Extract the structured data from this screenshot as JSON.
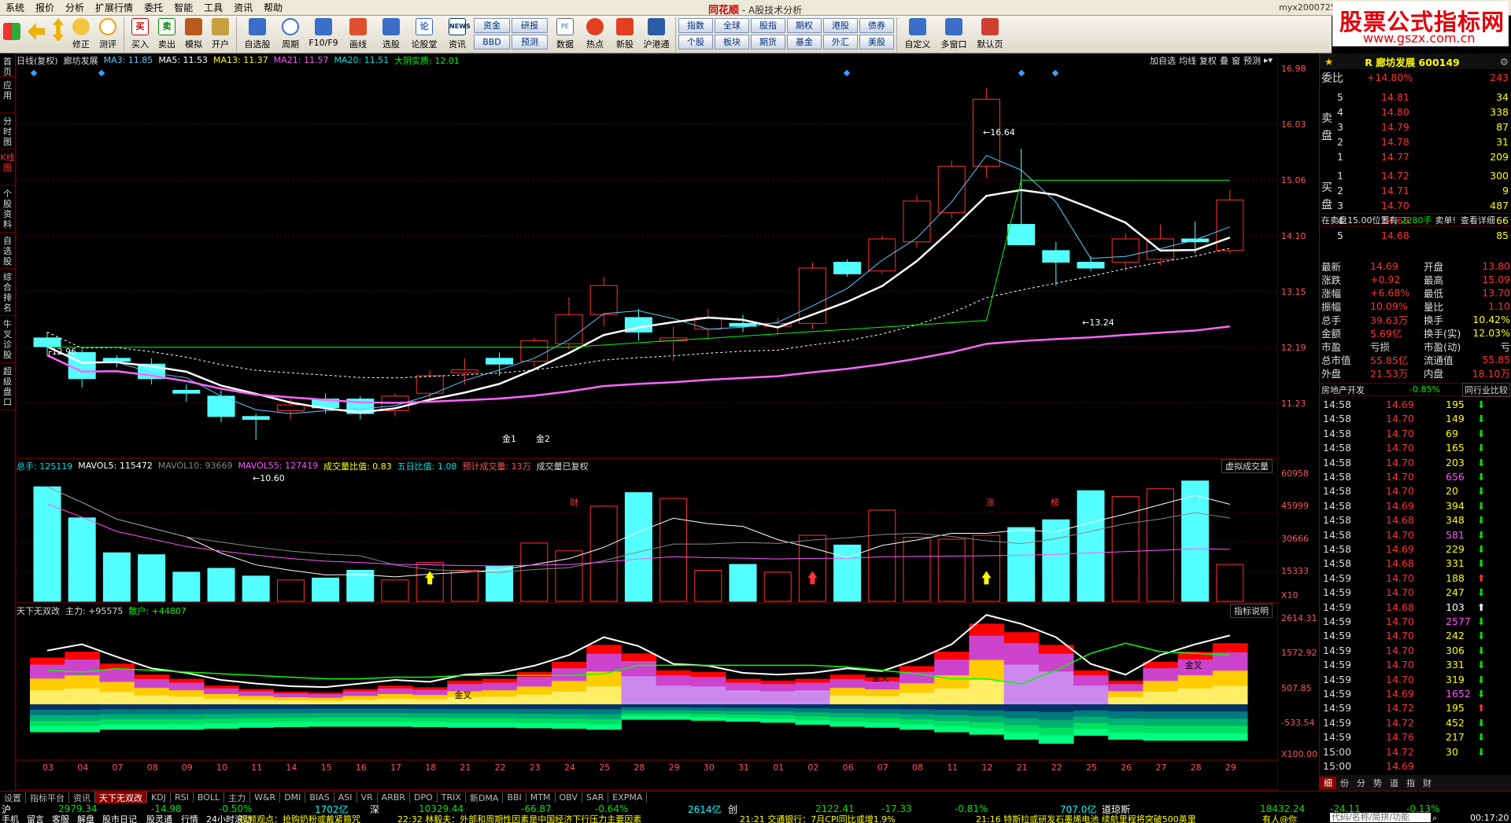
{
  "menu": {
    "items": [
      "系统",
      "报价",
      "分析",
      "扩展行情",
      "委托",
      "智能",
      "工具",
      "资讯",
      "帮助"
    ],
    "app_logo": "同花顺",
    "title": "A股技术分析",
    "user": "myx2000725"
  },
  "site_logo": {
    "line1": "股票公式指标网",
    "line2": "www.gszx.com.cn"
  },
  "toolbar": {
    "buttons": [
      "修正",
      "测评",
      "买入",
      "卖出",
      "模拟",
      "开户",
      "自选股",
      "周期",
      "F10/F9",
      "画线",
      "选股",
      "论股堂",
      "资讯",
      "数据",
      "热点",
      "新股",
      "沪港通",
      "自定义",
      "多窗口",
      "默认页"
    ],
    "grid1": [
      "资金",
      "研报",
      "BBD",
      "预测"
    ],
    "grid2": [
      "指数",
      "全球",
      "股指",
      "期权",
      "港股",
      "债券",
      "个股",
      "板块",
      "期货",
      "基金",
      "外汇",
      "美股"
    ]
  },
  "leftbar": [
    "首页",
    "应用",
    "分时图",
    "K线图",
    "个股资料",
    "自选股",
    "综合排名",
    "牛叉诊股",
    "超级盘口"
  ],
  "kline_header": {
    "period": "日线(复权)",
    "name": "廊坊发展",
    "ma3": "MA3: 11.85",
    "ma5": "MA5: 11.53",
    "ma13": "MA13: 11.37",
    "ma21": "MA21: 11.57",
    "ma20": "MA20: 11.51",
    "dayang": "大阴实质: 12.01",
    "tools": [
      "加自选",
      "均线",
      "复权",
      "叠",
      "窗",
      "预测"
    ]
  },
  "volume_header": {
    "total": "总手: 125119",
    "mavol5": "MAVOL5: 115472",
    "mavol10": "MAVOL10: 93669",
    "mavol55": "MAVOL55: 127419",
    "ratio": "成交量比值: 0.83",
    "five_day": "五日比值: 1.08",
    "forecast": "预计成交量: 13万",
    "restored": "成交量已复权",
    "menu": "虚拟成交量"
  },
  "indicator_header": {
    "name": "天下无双改",
    "main_force": "主力: +95575",
    "retail": "散户: +44807",
    "help": "指标说明"
  },
  "kline_axis": [
    "16.98",
    "16.03",
    "15.06",
    "14.10",
    "13.15",
    "12.19",
    "11.23"
  ],
  "volume_axis": [
    "60958",
    "45999",
    "30666",
    "15333",
    "X10"
  ],
  "indicator_axis": [
    "2614.31",
    "1572.92",
    "507.85",
    "-533.54",
    "X100.00"
  ],
  "dates": [
    "03",
    "04",
    "07",
    "08",
    "09",
    "10",
    "11",
    "14",
    "15",
    "16",
    "17",
    "18",
    "21",
    "22",
    "23",
    "24",
    "25",
    "28",
    "29",
    "30",
    "31",
    "01",
    "02",
    "06",
    "07",
    "08",
    "11",
    "12",
    "21",
    "22",
    "25",
    "26",
    "27",
    "28",
    "29"
  ],
  "annotations": {
    "high": "16.64",
    "low": "10.60",
    "mid_low": "13.24",
    "left_high": "12.96",
    "cross1": "金1",
    "cross2": "金2",
    "cross3": "金叉",
    "cross4": "金叉",
    "cross5": "金叉",
    "bottom_marks": [
      "财",
      "涨",
      "榜"
    ]
  },
  "chart_data": {
    "type": "candlestick",
    "ohlc": [
      [
        12.35,
        12.45,
        12.05,
        12.2
      ],
      [
        12.1,
        12.15,
        11.5,
        11.65
      ],
      [
        12.0,
        12.05,
        11.85,
        11.95
      ],
      [
        11.9,
        12.0,
        11.55,
        11.65
      ],
      [
        11.45,
        11.55,
        11.25,
        11.4
      ],
      [
        11.35,
        11.45,
        10.9,
        11.0
      ],
      [
        11.0,
        11.05,
        10.6,
        10.95
      ],
      [
        11.1,
        11.3,
        10.95,
        11.2
      ],
      [
        11.3,
        11.4,
        11.05,
        11.15
      ],
      [
        11.3,
        11.35,
        10.95,
        11.05
      ],
      [
        11.1,
        11.4,
        11.0,
        11.35
      ],
      [
        11.4,
        11.8,
        11.25,
        11.7
      ],
      [
        11.75,
        12.0,
        11.55,
        11.8
      ],
      [
        12.0,
        12.1,
        11.7,
        11.9
      ],
      [
        11.95,
        12.35,
        11.85,
        12.3
      ],
      [
        12.25,
        13.05,
        12.15,
        12.75
      ],
      [
        12.75,
        13.4,
        12.55,
        13.25
      ],
      [
        12.7,
        12.85,
        12.3,
        12.45
      ],
      [
        12.3,
        12.55,
        11.95,
        12.35
      ],
      [
        12.5,
        12.85,
        12.35,
        12.7
      ],
      [
        12.6,
        12.75,
        12.45,
        12.55
      ],
      [
        12.55,
        12.7,
        12.4,
        12.6
      ],
      [
        12.6,
        13.65,
        12.5,
        13.55
      ],
      [
        13.65,
        13.7,
        13.4,
        13.45
      ],
      [
        13.5,
        14.1,
        13.45,
        14.05
      ],
      [
        14.0,
        14.8,
        13.9,
        14.7
      ],
      [
        14.5,
        15.4,
        14.4,
        15.3
      ],
      [
        15.3,
        16.64,
        15.1,
        16.45
      ],
      [
        14.3,
        15.6,
        14.0,
        13.95
      ],
      [
        13.85,
        14.0,
        13.24,
        13.65
      ],
      [
        13.65,
        13.75,
        13.5,
        13.55
      ],
      [
        13.65,
        14.15,
        13.5,
        14.05
      ],
      [
        13.7,
        14.3,
        13.6,
        14.05
      ],
      [
        14.05,
        14.35,
        13.8,
        14.0
      ],
      [
        13.85,
        14.9,
        13.8,
        14.72
      ]
    ],
    "volume": [
      59000,
      43000,
      25000,
      24000,
      15000,
      17000,
      13000,
      11000,
      12000,
      16000,
      11000,
      20000,
      16000,
      18000,
      30000,
      26000,
      49000,
      56000,
      53000,
      16000,
      19000,
      15000,
      34000,
      29000,
      47000,
      33000,
      32000,
      34000,
      38000,
      42000,
      57000,
      54000,
      58000,
      62000,
      19000
    ]
  },
  "right_panel": {
    "stock_label": "R 廊坊发展 600149",
    "weibi_label": "委比",
    "weibi": "+14.80%",
    "weicha": "243",
    "sell": [
      [
        "5",
        "14.81",
        "34"
      ],
      [
        "4",
        "14.80",
        "338"
      ],
      [
        "3",
        "14.79",
        "87"
      ],
      [
        "2",
        "14.78",
        "31"
      ],
      [
        "1",
        "14.77",
        "209"
      ]
    ],
    "buy": [
      [
        "1",
        "14.72",
        "300"
      ],
      [
        "2",
        "14.71",
        "9"
      ],
      [
        "3",
        "14.70",
        "487"
      ],
      [
        "4",
        "14.69",
        "66"
      ],
      [
        "5",
        "14.68",
        "85"
      ]
    ],
    "sell_side": "卖",
    "sell_side2": "盘",
    "buy_side": "买",
    "buy_side2": "盘",
    "msg": [
      "在卖盘15.00位置有",
      "2280手",
      "卖单!",
      "查看详细"
    ],
    "stats": [
      [
        "最新",
        "14.69",
        "开盘",
        "13.80"
      ],
      [
        "涨跌",
        "+0.92",
        "最高",
        "15.09"
      ],
      [
        "涨幅",
        "+6.68%",
        "最低",
        "13.70"
      ],
      [
        "振幅",
        "10.09%",
        "量比",
        "1.10"
      ],
      [
        "总手",
        "39.63万",
        "换手",
        "10.42%"
      ],
      [
        "金额",
        "5.69亿",
        "换手(实)",
        "12.03%"
      ],
      [
        "市盈",
        "亏损",
        "市盈(动)",
        "亏"
      ],
      [
        "总市值",
        "55.85亿",
        "流通值",
        "55.85"
      ],
      [
        "外盘",
        "21.53万",
        "内盘",
        "18.10万"
      ]
    ],
    "sector": "房地产开发",
    "sector_chg": "-0.85%",
    "sector_btn": "同行业比较",
    "ticks": [
      [
        "14:58",
        "14.69",
        "195",
        "d"
      ],
      [
        "14:58",
        "14.70",
        "149",
        "d"
      ],
      [
        "14:58",
        "14.70",
        "69",
        "d"
      ],
      [
        "14:58",
        "14.70",
        "165",
        "d"
      ],
      [
        "14:58",
        "14.70",
        "203",
        "d"
      ],
      [
        "14:58",
        "14.70",
        "656",
        "d"
      ],
      [
        "14:58",
        "14.70",
        "20",
        "d"
      ],
      [
        "14:58",
        "14.69",
        "394",
        "d"
      ],
      [
        "14:58",
        "14.68",
        "348",
        "d"
      ],
      [
        "14:58",
        "14.70",
        "581",
        "d"
      ],
      [
        "14:58",
        "14.69",
        "229",
        "d"
      ],
      [
        "14:58",
        "14.68",
        "331",
        "d"
      ],
      [
        "14:59",
        "14.70",
        "188",
        "u"
      ],
      [
        "14:59",
        "14.70",
        "247",
        "d"
      ],
      [
        "14:59",
        "14.68",
        "103",
        "w"
      ],
      [
        "14:59",
        "14.70",
        "2577",
        "d"
      ],
      [
        "14:59",
        "14.70",
        "242",
        "d"
      ],
      [
        "14:59",
        "14.70",
        "306",
        "d"
      ],
      [
        "14:59",
        "14.70",
        "331",
        "d"
      ],
      [
        "14:59",
        "14.70",
        "319",
        "d"
      ],
      [
        "14:59",
        "14.69",
        "1652",
        "d"
      ],
      [
        "14:59",
        "14.72",
        "195",
        "u"
      ],
      [
        "14:59",
        "14.72",
        "452",
        "d"
      ],
      [
        "14:59",
        "14.76",
        "217",
        "d"
      ],
      [
        "15:00",
        "14.72",
        "30",
        "d"
      ],
      [
        "15:00",
        "14.69",
        "",
        ""
      ]
    ],
    "bottom_tabs": [
      "细",
      "份",
      "分",
      "势",
      "道",
      "指",
      "财"
    ]
  },
  "tabs": [
    "设置",
    "指标平台",
    "资讯",
    "天下无双改",
    "KDJ",
    "RSI",
    "BOLL",
    "主力",
    "W&R",
    "DMI",
    "BIAS",
    "ASI",
    "VR",
    "ARBR",
    "DPO",
    "TRIX",
    "新DMA",
    "BBI",
    "MTM",
    "OBV",
    "SAR",
    "EXPMA"
  ],
  "status": {
    "sh_label": "沪",
    "sh_idx": "2979.34",
    "sh_chg": "-14.98",
    "sh_pct": "-0.50%",
    "sh_amt": "1702亿",
    "sz_label": "深",
    "sz_idx": "10329.44",
    "sz_chg": "-66.87",
    "sz_pct": "-0.64%",
    "sz_amt": "2614亿",
    "cy_label": "创",
    "cy_idx": "2122.41",
    "cy_chg": "-17.33",
    "cy_pct": "-0.81%",
    "cy_amt": "707.0亿",
    "dj_label": "道琼斯",
    "dj_idx": "18432.24",
    "dj_chg": "-24.11",
    "dj_pct": "-0.13%",
    "row2": [
      "手机",
      "留言",
      "客服",
      "解盘",
      "股市日记",
      "股灵通",
      "行情",
      "24小时滚动"
    ],
    "news": [
      "视频观点：抢购奶粉或戴紧箍咒",
      "22:32 林毅夫：外部和周期性因素是中国经济下行压力主要因素",
      "21:21 交通银行：7月CPI同比或增1.9%",
      "21:16 特斯拉或研发石墨烯电池 续航里程将突破500英里"
    ],
    "chat": "有人@你",
    "search": "代码/名称/简拼/功能",
    "clock": "00:17:20"
  }
}
